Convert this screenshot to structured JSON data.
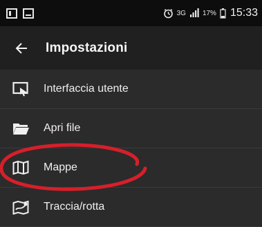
{
  "status_bar": {
    "network_label": "3G",
    "battery_percent": "17%",
    "time": "15:33",
    "icons": [
      "notification-icon",
      "gallery-icon",
      "alarm-icon",
      "signal-icon",
      "battery-icon"
    ]
  },
  "app_bar": {
    "title": "Impostazioni",
    "back_icon": "arrow-left-icon"
  },
  "settings_items": [
    {
      "label": "Interfaccia utente",
      "icon": "user-interface-icon"
    },
    {
      "label": "Apri file",
      "icon": "folder-icon"
    },
    {
      "label": "Mappe",
      "icon": "map-icon"
    },
    {
      "label": "Traccia/rotta",
      "icon": "track-route-icon"
    }
  ],
  "annotation": {
    "type": "ellipse",
    "color": "#d61f2a",
    "target": "Mappe"
  },
  "colors": {
    "status_bar_bg": "#0d0d0d",
    "app_bar_bg": "#202020",
    "list_bg": "#2b2b2b",
    "highlight_red": "#d61f2a"
  }
}
